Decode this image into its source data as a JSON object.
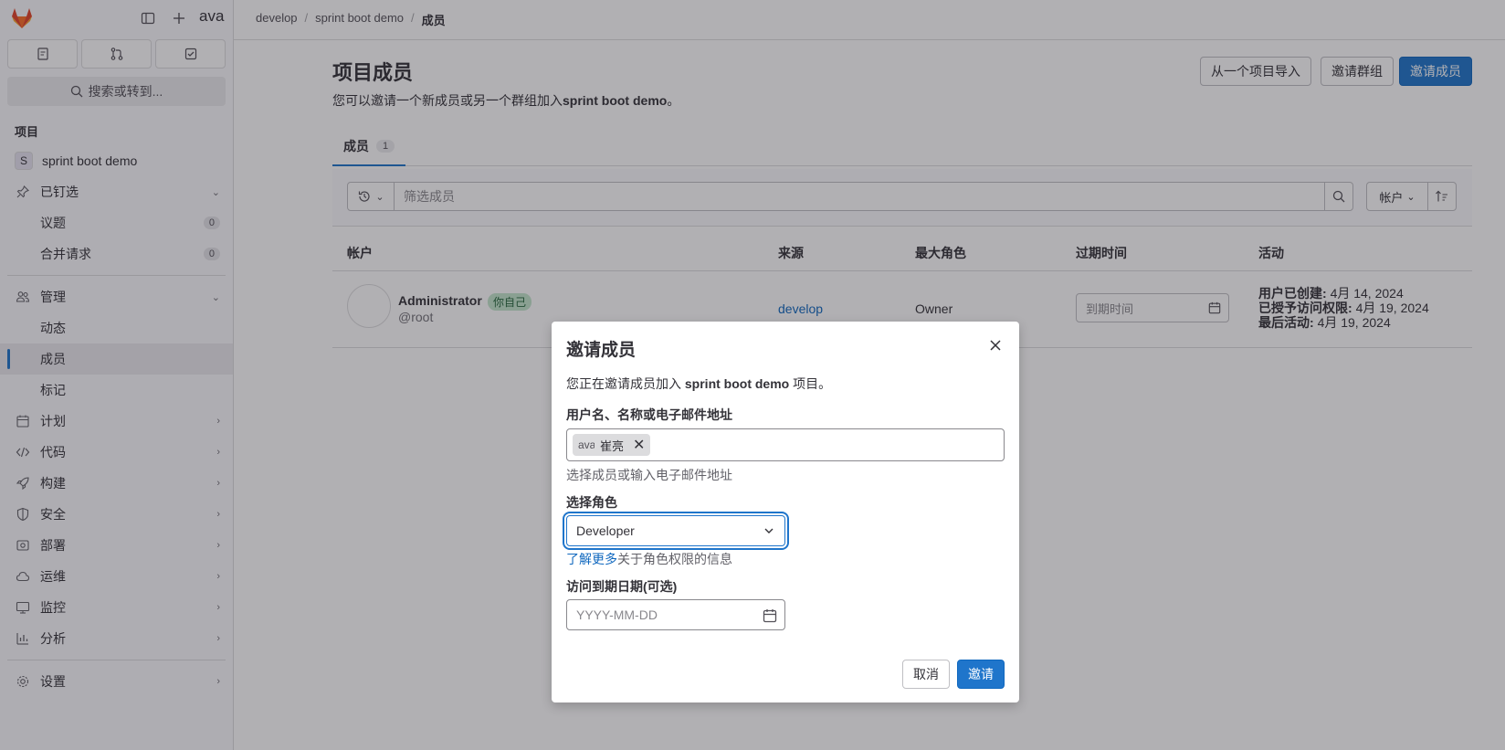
{
  "topbar": {
    "user_text": "ava"
  },
  "sidebar": {
    "search_label": "搜索或转到...",
    "section_title": "项目",
    "project": {
      "avatar_letter": "S",
      "name": "sprint boot demo"
    },
    "pinned": {
      "label": "已钉选",
      "items": [
        {
          "label": "议题",
          "count": "0"
        },
        {
          "label": "合并请求",
          "count": "0"
        }
      ]
    },
    "manage": {
      "label": "管理",
      "items": [
        {
          "label": "动态"
        },
        {
          "label": "成员"
        },
        {
          "label": "标记"
        }
      ]
    },
    "nav": [
      {
        "label": "计划",
        "icon": "plan-icon"
      },
      {
        "label": "代码",
        "icon": "code-icon"
      },
      {
        "label": "构建",
        "icon": "rocket-icon"
      },
      {
        "label": "安全",
        "icon": "shield-icon"
      },
      {
        "label": "部署",
        "icon": "deploy-icon"
      },
      {
        "label": "运维",
        "icon": "cloud-icon"
      },
      {
        "label": "监控",
        "icon": "monitor-icon"
      },
      {
        "label": "分析",
        "icon": "chart-icon"
      },
      {
        "label": "设置",
        "icon": "gear-icon"
      }
    ]
  },
  "breadcrumb": {
    "items": [
      "develop",
      "sprint boot demo",
      "成员"
    ]
  },
  "header": {
    "title": "项目成员",
    "desc_prefix": "您可以邀请一个新成员或另一个群组加入",
    "desc_project": "sprint boot demo",
    "desc_suffix": "。",
    "btn_import": "从一个项目导入",
    "btn_invite_group": "邀请群组",
    "btn_invite_member": "邀请成员"
  },
  "tabs": {
    "members_label": "成员",
    "members_count": "1"
  },
  "filter": {
    "placeholder": "筛选成员",
    "sort_label": "帐户"
  },
  "table": {
    "headers": {
      "account": "帐户",
      "source": "来源",
      "max_role": "最大角色",
      "expiration": "过期时间",
      "activity": "活动"
    },
    "rows": [
      {
        "name": "Administrator",
        "badge": "你自己",
        "handle": "@root",
        "source": "develop",
        "role": "Owner",
        "expiration_placeholder": "到期时间",
        "created_label": "用户已创建:",
        "created_value": "4月 14, 2024",
        "granted_label": "已授予访问权限:",
        "granted_value": "4月 19, 2024",
        "last_label": "最后活动:",
        "last_value": "4月 19, 2024"
      }
    ]
  },
  "modal": {
    "title": "邀请成员",
    "intro_prefix": "您正在邀请成员加入",
    "intro_project": "sprint boot demo",
    "intro_suffix": "项目。",
    "user_field_label": "用户名、名称或电子邮件地址",
    "token_avatar_text": "ava",
    "token_label": "崔亮",
    "user_field_help": "选择成员或输入电子邮件地址",
    "role_label": "选择角色",
    "role_value": "Developer",
    "role_help_link": "了解更多",
    "role_help_text": "关于角色权限的信息",
    "date_label": "访问到期日期(可选)",
    "date_placeholder": "YYYY-MM-DD",
    "cancel_label": "取消",
    "invite_label": "邀请"
  },
  "colors": {
    "primary": "#1f75cb",
    "overlay": "rgba(31,30,36,0.35)"
  }
}
